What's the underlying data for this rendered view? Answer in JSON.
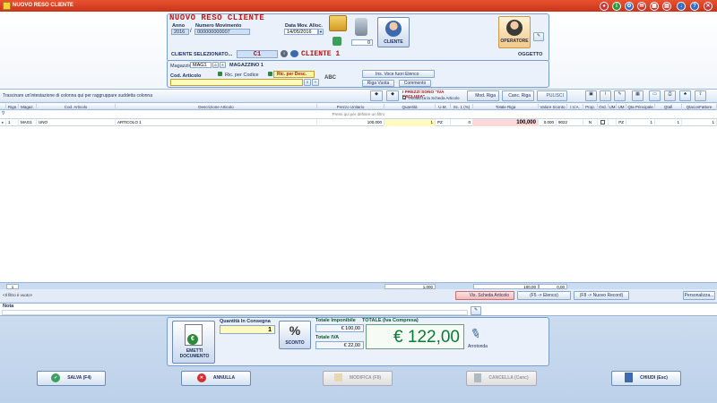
{
  "window": {
    "title": "NUOVO RESO CLIENTE"
  },
  "header": {
    "form_title": "NUOVO RESO CLIENTE",
    "anno_label": "Anno",
    "anno_value": "2016",
    "numero_label": "Numero Movimento",
    "numero_value": "000000000007",
    "data_label": "Data Mov. Alloc.",
    "data_value": "14/05/2016",
    "small_counter": "0",
    "cliente_button": "CLIENTE",
    "operatore_button": "OPERATORE",
    "cliente_selezionato_label": "CLIENTE SELEZIONATO...",
    "cliente_code": "C1",
    "cliente_name": "CLIENTE 1",
    "oggetto_label": "OGGETTO"
  },
  "articolo": {
    "magazzino_label": "Magazzino",
    "magazzino_code": "MAG1",
    "magazzino_name": "MAGAZZINO 1",
    "cod_label": "Cod. Articolo",
    "ric_codice": "Ric. per Codice",
    "ric_desc": "Ric. per Desc.",
    "ins_voce": "Ins. Voce fuori Elenco",
    "riga_vuota": "Riga Vuota",
    "commento": "Commento"
  },
  "toolbar": {
    "drag_hint": "Trascinare un'intestazione di colonna qui per raggruppare suddetta colonna",
    "prezzi_label": "I PREZZI SONO \"IVA ESCLUSA\"",
    "usa_scheda": "Visualizza la Scheda Articolo",
    "mod_riga": "Mod. Riga",
    "canc_riga": "Canc. Riga",
    "pulisci": "PULISCI"
  },
  "grid": {
    "columns": [
      "Riga",
      "Magaz.",
      "Cod. Articolo",
      "Descrizione Articolo",
      "Prezzo Unitario",
      "Quantità",
      "U.M.",
      "Sc. 1 (%)",
      "Totale Riga",
      "Valore Sconto",
      "I.V.A.",
      "Prop.",
      "Ord.",
      "UM",
      "UM",
      "Qta Principale",
      "Qtall",
      "QtaconFattore"
    ],
    "filter_hint": "Premi qui per definire un filtro",
    "rows": [
      {
        "riga": "1",
        "magaz": "MAG1",
        "cod": "UNO",
        "desc": "ARTICOLO 1",
        "prezzo": "100,000",
        "qta": "1",
        "um": "PZ",
        "sc": "0",
        "totale": "100,000",
        "valore_sconto": "0,000",
        "iva": "9022",
        "prop": "N",
        "um2": "PZ",
        "qta_princ": "1",
        "qtall": "1",
        "qtacon": "1"
      }
    ],
    "totals": {
      "count": "1",
      "qta": "1,000",
      "totale": "100,00",
      "sconto": "0,00"
    }
  },
  "bottom": {
    "filter_state": "<Il filtro è vuoto>",
    "vis_scheda": "Vis. Scheda Articolo",
    "f5_elenco": "(F5 -> Elenco)",
    "f8_nuovo": "(F8 -> Nuovo Record)",
    "personalizza": "Personalizza...",
    "nota_label": "Nota"
  },
  "summary": {
    "emetti": "EMETTI DOCUMENTO",
    "qta_consegna_label": "Quantità In Consegna",
    "qta_consegna": "1",
    "sconto_button": "SCONTO",
    "imponibile_label": "Totale Imponibile",
    "imponibile": "€ 100,00",
    "iva_label": "Totale IVA",
    "iva": "€ 22,00",
    "totale_label": "TOTALE (Iva Compresa)",
    "totale": "€ 122,00",
    "arrotonda": "Arrotonda"
  },
  "footer": {
    "salva": "SALVA (F4)",
    "annulla": "ANNULLA",
    "modifica": "MODIFICA (F8)",
    "cancella": "CANCELLA (Canc)",
    "chiudi": "CHIUDI (Esc)"
  }
}
